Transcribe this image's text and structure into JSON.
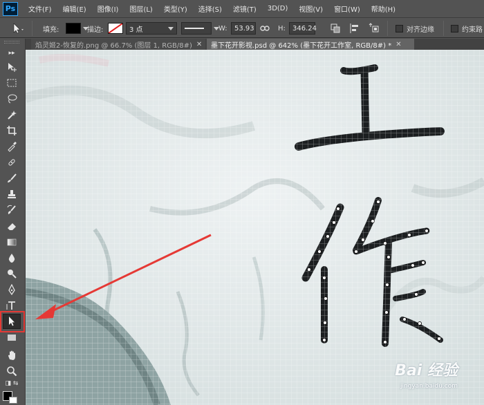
{
  "app": {
    "logo_text": "Ps",
    "menu": [
      "文件(F)",
      "编辑(E)",
      "图像(I)",
      "图层(L)",
      "类型(Y)",
      "选择(S)",
      "滤镜(T)",
      "3D(D)",
      "视图(V)",
      "窗口(W)",
      "帮助(H)"
    ]
  },
  "options": {
    "fill_label": "填充:",
    "fill_color": "#000000",
    "stroke_label": "描边:",
    "stroke_size": "3 点",
    "width_label": "W:",
    "width_value": "53.93",
    "height_label": "H:",
    "height_value": "346.24",
    "align_edges_label": "对齐边缘",
    "constrain_label": "约束路"
  },
  "tabs": [
    {
      "label": "焰灵姬2-恢复的.png @ 66.7% (图层 1, RGB/8#)",
      "active": false
    },
    {
      "label": "墨下花开影视.psd @ 642% (墨下花开工作室, RGB/8#) *",
      "active": true
    }
  ],
  "toolbar": {
    "tools": [
      "move-tool",
      "marquee-tool",
      "lasso-tool",
      "quick-select-tool",
      "crop-tool",
      "eyedropper-tool",
      "healing-brush-tool",
      "brush-tool",
      "clone-stamp-tool",
      "history-brush-tool",
      "eraser-tool",
      "gradient-tool",
      "blur-tool",
      "dodge-tool",
      "pen-tool",
      "type-tool",
      "path-selection-tool",
      "rectangle-tool",
      "hand-tool",
      "zoom-tool"
    ],
    "active_tool": "path-selection-tool",
    "highlight_color": "#e53935"
  },
  "canvas": {
    "zoom": "642%"
  },
  "watermark": {
    "text": "Bai 经验",
    "sub": "jingyan.baidu.com"
  }
}
